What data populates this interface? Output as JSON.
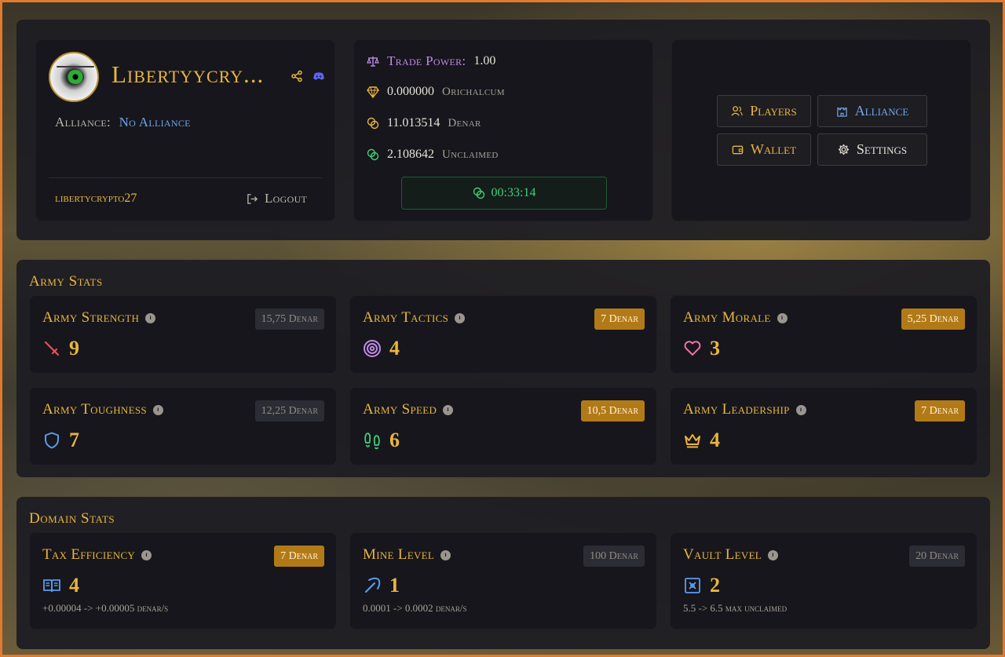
{
  "profile": {
    "username": "Libertyycry...",
    "alliance_label": "Alliance:",
    "alliance_value": "No Alliance",
    "handle": "libertycrypto27",
    "logout_label": "Logout",
    "avatar_icon": "eye-avatar",
    "share_icon": "share-icon",
    "discord_icon": "discord-icon"
  },
  "economy": {
    "trade_power_label": "Trade Power:",
    "trade_power_value": "1.00",
    "orichalcum_value": "0.000000",
    "orichalcum_unit": "Orichalcum",
    "denar_value": "11.013514",
    "denar_unit": "Denar",
    "unclaimed_value": "2.108642",
    "unclaimed_unit": "Unclaimed",
    "timer": "00:33:14"
  },
  "nav": {
    "players": "Players",
    "alliance": "Alliance",
    "wallet": "Wallet",
    "settings": "Settings"
  },
  "army": {
    "title": "Army Stats",
    "items": [
      {
        "name": "Army Strength",
        "cost": "15,75 Denar",
        "value": "9",
        "icon": "sword-icon",
        "affordable": false
      },
      {
        "name": "Army Tactics",
        "cost": "7 Denar",
        "value": "4",
        "icon": "target-icon",
        "affordable": true
      },
      {
        "name": "Army Morale",
        "cost": "5,25 Denar",
        "value": "3",
        "icon": "heart-icon",
        "affordable": true
      },
      {
        "name": "Army Toughness",
        "cost": "12,25 Denar",
        "value": "7",
        "icon": "shield-icon",
        "affordable": false
      },
      {
        "name": "Army Speed",
        "cost": "10,5 Denar",
        "value": "6",
        "icon": "footprints-icon",
        "affordable": true
      },
      {
        "name": "Army Leadership",
        "cost": "7 Denar",
        "value": "4",
        "icon": "crown-icon",
        "affordable": true
      }
    ]
  },
  "domain": {
    "title": "Domain Stats",
    "items": [
      {
        "name": "Tax Efficiency",
        "cost": "7 Denar",
        "value": "4",
        "desc": "+0.00004 -> +0.00005 denar/s",
        "icon": "book-icon",
        "affordable": true
      },
      {
        "name": "Mine Level",
        "cost": "100 Denar",
        "value": "1",
        "desc": "0.0001 -> 0.0002 denar/s",
        "icon": "pickaxe-icon",
        "affordable": false
      },
      {
        "name": "Vault Level",
        "cost": "20 Denar",
        "value": "2",
        "desc": "5.5 -> 6.5 max unclaimed",
        "icon": "vault-icon",
        "affordable": false
      }
    ]
  },
  "colors": {
    "gold": "#e9b53c",
    "gold_badge": "#b27a17",
    "link_blue": "#6fa6e8",
    "purple": "#c08ae8",
    "green": "#3fcf7a",
    "frame": "#e07a2e"
  }
}
